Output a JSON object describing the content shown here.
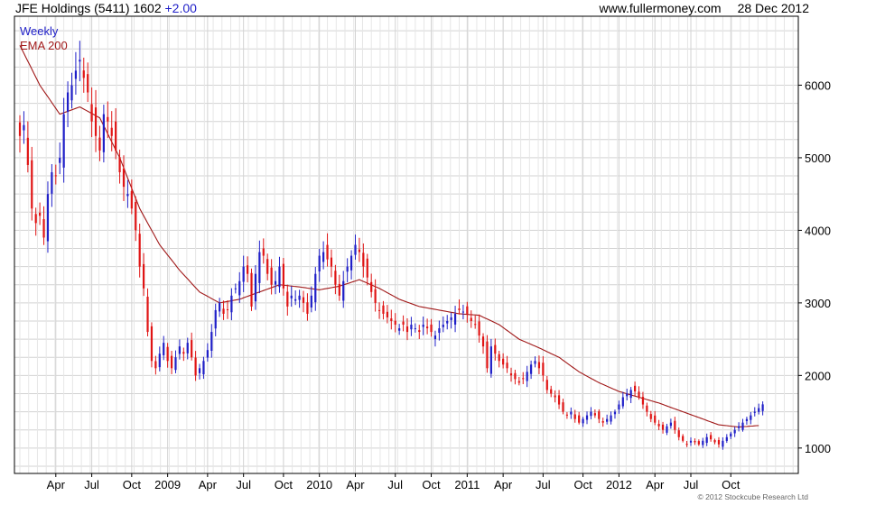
{
  "header": {
    "title": "JFE Holdings (5411) 1602",
    "change": "+2.00",
    "website": "www.fullermoney.com",
    "date": "28 Dec 2012"
  },
  "footer": {
    "copyright": "© 2012 Stockcube Research Ltd"
  },
  "colors": {
    "up": "#1f1fc8",
    "down": "#e01414",
    "ema": "#a01818",
    "grid": "#d3d3d3",
    "axis": "#000000"
  },
  "chart_data": {
    "type": "candlestick",
    "timeframe_label": "Weekly",
    "indicator_label": "EMA 200",
    "legend_position": "top-left",
    "y_axis_side": "right",
    "grid": true,
    "ylim": [
      650,
      6950
    ],
    "y_ticks": [
      1000,
      2000,
      3000,
      4000,
      5000,
      6000
    ],
    "x_ticks": [
      {
        "label": "Apr",
        "week": 9
      },
      {
        "label": "Jul",
        "week": 18
      },
      {
        "label": "Oct",
        "week": 28
      },
      {
        "label": "2009",
        "week": 37
      },
      {
        "label": "Apr",
        "week": 47
      },
      {
        "label": "Jul",
        "week": 56
      },
      {
        "label": "Oct",
        "week": 66
      },
      {
        "label": "2010",
        "week": 75
      },
      {
        "label": "Apr",
        "week": 84
      },
      {
        "label": "Jul",
        "week": 94
      },
      {
        "label": "Oct",
        "week": 103
      },
      {
        "label": "2011",
        "week": 112
      },
      {
        "label": "Apr",
        "week": 121
      },
      {
        "label": "Jul",
        "week": 131
      },
      {
        "label": "Oct",
        "week": 141
      },
      {
        "label": "2012",
        "week": 150
      },
      {
        "label": "Apr",
        "week": 159
      },
      {
        "label": "Jul",
        "week": 168
      },
      {
        "label": "Oct",
        "week": 178
      }
    ],
    "weeks_total": 194,
    "close_keypoints": [
      [
        0,
        5300
      ],
      [
        1,
        5450
      ],
      [
        2,
        4900
      ],
      [
        3,
        4300
      ],
      [
        4,
        4100
      ],
      [
        5,
        4200
      ],
      [
        6,
        3900
      ],
      [
        7,
        4500
      ],
      [
        8,
        4800
      ],
      [
        9,
        4750
      ],
      [
        10,
        5000
      ],
      [
        11,
        5600
      ],
      [
        12,
        5900
      ],
      [
        13,
        6000
      ],
      [
        14,
        6200
      ],
      [
        15,
        6350
      ],
      [
        16,
        6100
      ],
      [
        17,
        5900
      ],
      [
        18,
        5500
      ],
      [
        19,
        5300
      ],
      [
        20,
        5100
      ],
      [
        21,
        5600
      ],
      [
        22,
        5500
      ],
      [
        23,
        5300
      ],
      [
        24,
        5100
      ],
      [
        25,
        4800
      ],
      [
        26,
        4600
      ],
      [
        27,
        4500
      ],
      [
        28,
        4300
      ],
      [
        29,
        4000
      ],
      [
        30,
        3500
      ],
      [
        31,
        3200
      ],
      [
        32,
        2600
      ],
      [
        33,
        2200
      ],
      [
        34,
        2100
      ],
      [
        35,
        2300
      ],
      [
        36,
        2450
      ],
      [
        37,
        2200
      ],
      [
        38,
        2100
      ],
      [
        39,
        2250
      ],
      [
        40,
        2400
      ],
      [
        41,
        2300
      ],
      [
        42,
        2450
      ],
      [
        43,
        2250
      ],
      [
        44,
        2000
      ],
      [
        45,
        2100
      ],
      [
        46,
        2200
      ],
      [
        47,
        2350
      ],
      [
        48,
        2600
      ],
      [
        49,
        2900
      ],
      [
        50,
        3000
      ],
      [
        51,
        2850
      ],
      [
        52,
        2900
      ],
      [
        53,
        3100
      ],
      [
        54,
        3200
      ],
      [
        55,
        3300
      ],
      [
        56,
        3500
      ],
      [
        57,
        3400
      ],
      [
        58,
        2950
      ],
      [
        59,
        3400
      ],
      [
        60,
        3700
      ],
      [
        61,
        3650
      ],
      [
        62,
        3400
      ],
      [
        63,
        3250
      ],
      [
        64,
        3300
      ],
      [
        65,
        3500
      ],
      [
        66,
        3200
      ],
      [
        67,
        2950
      ],
      [
        68,
        3100
      ],
      [
        69,
        3050
      ],
      [
        70,
        3100
      ],
      [
        71,
        3000
      ],
      [
        72,
        2850
      ],
      [
        73,
        3100
      ],
      [
        74,
        3400
      ],
      [
        75,
        3650
      ],
      [
        76,
        3700
      ],
      [
        77,
        3600
      ],
      [
        78,
        3500
      ],
      [
        79,
        3250
      ],
      [
        80,
        3100
      ],
      [
        81,
        3300
      ],
      [
        82,
        3500
      ],
      [
        83,
        3650
      ],
      [
        84,
        3800
      ],
      [
        85,
        3700
      ],
      [
        86,
        3500
      ],
      [
        87,
        3350
      ],
      [
        88,
        3150
      ],
      [
        89,
        3000
      ],
      [
        90,
        2900
      ],
      [
        91,
        2850
      ],
      [
        92,
        2800
      ],
      [
        93,
        2750
      ],
      [
        94,
        2700
      ],
      [
        95,
        2650
      ],
      [
        96,
        2700
      ],
      [
        97,
        2600
      ],
      [
        98,
        2700
      ],
      [
        99,
        2650
      ],
      [
        100,
        2600
      ],
      [
        101,
        2700
      ],
      [
        102,
        2650
      ],
      [
        103,
        2600
      ],
      [
        104,
        2550
      ],
      [
        105,
        2650
      ],
      [
        106,
        2700
      ],
      [
        107,
        2750
      ],
      [
        108,
        2800
      ],
      [
        109,
        2850
      ],
      [
        110,
        2900
      ],
      [
        111,
        2880
      ],
      [
        112,
        2850
      ],
      [
        113,
        2750
      ],
      [
        114,
        2700
      ],
      [
        115,
        2550
      ],
      [
        116,
        2400
      ],
      [
        117,
        2100
      ],
      [
        118,
        2400
      ],
      [
        119,
        2300
      ],
      [
        120,
        2200
      ],
      [
        121,
        2150
      ],
      [
        122,
        2100
      ],
      [
        123,
        2000
      ],
      [
        124,
        1950
      ],
      [
        125,
        1900
      ],
      [
        126,
        1950
      ],
      [
        127,
        2050
      ],
      [
        128,
        2150
      ],
      [
        129,
        2200
      ],
      [
        130,
        2100
      ],
      [
        131,
        2000
      ],
      [
        132,
        1800
      ],
      [
        133,
        1750
      ],
      [
        134,
        1700
      ],
      [
        135,
        1600
      ],
      [
        136,
        1500
      ],
      [
        137,
        1450
      ],
      [
        138,
        1500
      ],
      [
        139,
        1400
      ],
      [
        140,
        1350
      ],
      [
        141,
        1400
      ],
      [
        142,
        1450
      ],
      [
        143,
        1500
      ],
      [
        144,
        1450
      ],
      [
        145,
        1400
      ],
      [
        146,
        1350
      ],
      [
        147,
        1400
      ],
      [
        148,
        1450
      ],
      [
        149,
        1500
      ],
      [
        150,
        1600
      ],
      [
        151,
        1700
      ],
      [
        152,
        1750
      ],
      [
        153,
        1800
      ],
      [
        154,
        1780
      ],
      [
        155,
        1700
      ],
      [
        156,
        1600
      ],
      [
        157,
        1500
      ],
      [
        158,
        1400
      ],
      [
        159,
        1350
      ],
      [
        160,
        1300
      ],
      [
        161,
        1250
      ],
      [
        162,
        1300
      ],
      [
        163,
        1350
      ],
      [
        164,
        1250
      ],
      [
        165,
        1150
      ],
      [
        166,
        1100
      ],
      [
        167,
        1050
      ],
      [
        168,
        1100
      ],
      [
        169,
        1080
      ],
      [
        170,
        1050
      ],
      [
        171,
        1100
      ],
      [
        172,
        1150
      ],
      [
        173,
        1120
      ],
      [
        174,
        1080
      ],
      [
        175,
        1050
      ],
      [
        176,
        1100
      ],
      [
        177,
        1150
      ],
      [
        178,
        1200
      ],
      [
        179,
        1250
      ],
      [
        180,
        1300
      ],
      [
        181,
        1350
      ],
      [
        182,
        1400
      ],
      [
        183,
        1450
      ],
      [
        184,
        1500
      ],
      [
        185,
        1550
      ],
      [
        186,
        1602
      ]
    ],
    "ema200_keypoints": [
      [
        0,
        6550
      ],
      [
        5,
        6000
      ],
      [
        10,
        5600
      ],
      [
        15,
        5700
      ],
      [
        20,
        5550
      ],
      [
        25,
        5000
      ],
      [
        30,
        4300
      ],
      [
        35,
        3800
      ],
      [
        40,
        3450
      ],
      [
        45,
        3150
      ],
      [
        50,
        3000
      ],
      [
        55,
        3050
      ],
      [
        60,
        3150
      ],
      [
        65,
        3250
      ],
      [
        70,
        3220
      ],
      [
        75,
        3180
      ],
      [
        80,
        3230
      ],
      [
        85,
        3320
      ],
      [
        90,
        3200
      ],
      [
        95,
        3050
      ],
      [
        100,
        2950
      ],
      [
        105,
        2900
      ],
      [
        110,
        2850
      ],
      [
        115,
        2830
      ],
      [
        120,
        2700
      ],
      [
        125,
        2500
      ],
      [
        130,
        2380
      ],
      [
        135,
        2250
      ],
      [
        140,
        2050
      ],
      [
        145,
        1900
      ],
      [
        150,
        1780
      ],
      [
        155,
        1700
      ],
      [
        160,
        1620
      ],
      [
        165,
        1520
      ],
      [
        170,
        1420
      ],
      [
        175,
        1320
      ],
      [
        180,
        1290
      ],
      [
        185,
        1310
      ]
    ]
  }
}
